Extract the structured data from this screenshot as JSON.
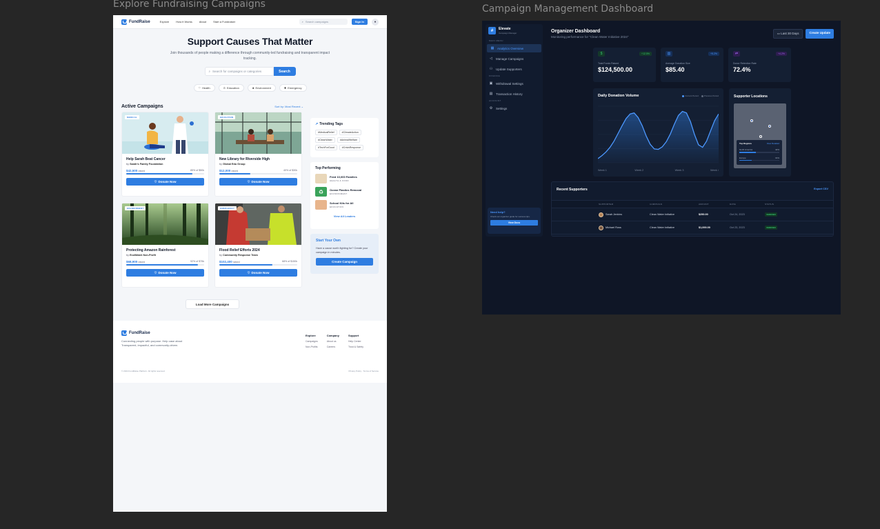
{
  "canvas": {
    "left_title": "Explore Fundraising Campaigns",
    "right_title": "Campaign Management Dashboard"
  },
  "fundraise": {
    "brand": "FundRaise",
    "nav": [
      "Explore",
      "How it Works",
      "About",
      "Start a Fundraiser"
    ],
    "search_placeholder": "Search campaigns",
    "signin_label": "Sign In",
    "hero": {
      "title": "Support Causes That Matter",
      "subtitle": "Join thousands of people making a difference through community-led fundraising and transparent impact tracking.",
      "search_placeholder": "Search for campaigns or categories",
      "search_button": "Search"
    },
    "categories": [
      "Health",
      "Education",
      "Environment",
      "Emergency"
    ],
    "active": {
      "title": "Active Campaigns",
      "sort_label": "Sort by: Most Recent ⌄"
    },
    "campaigns": [
      {
        "tag": "MEDICAL",
        "title": "Help Sarah Beat Cancer",
        "by": "by",
        "org": "Sarah's Family Foundation",
        "raised": "$42,500",
        "raised_word": "raised",
        "goal": "85% of $50k",
        "progress": 0.85,
        "donate": "Donate Now"
      },
      {
        "tag": "EDUCATION",
        "title": "New Library for Riverside High",
        "by": "by",
        "org": "Global Edu Group",
        "raised": "$12,000",
        "raised_word": "raised",
        "goal": "40% of $30k",
        "progress": 0.4,
        "donate": "Donate Now"
      },
      {
        "tag": "ENVIRONMENT",
        "title": "Protecting Amazon Rainforest",
        "by": "by",
        "org": "EcoWatch Non-Profit",
        "raised": "$68,900",
        "raised_word": "raised",
        "goal": "92% of $75k",
        "progress": 0.92,
        "donate": "Donate Now"
      },
      {
        "tag": "EMERGENCY",
        "title": "Flood Relief Efforts 2024",
        "by": "by",
        "org": "Community Response Team",
        "raised": "$102,400",
        "raised_word": "raised",
        "goal": "68% of $150k",
        "progress": 0.68,
        "donate": "Donate Now"
      }
    ],
    "load_more": "Load More Campaigns",
    "trending": {
      "title": "Trending Tags",
      "tags": [
        "#MedicalRelief",
        "#ClimateAction",
        "#CleanWater",
        "#AnimalWelfare",
        "#TechForGood",
        "#CrisisResponse"
      ]
    },
    "top_performing": {
      "title": "Top Performing",
      "items": [
        {
          "name": "Feed 10,000 Families",
          "cat": "HEALTH & FOOD"
        },
        {
          "name": "Ocean Plastics Removal",
          "cat": "ENVIRONMENT"
        },
        {
          "name": "School Kits for All",
          "cat": "EDUCATION"
        }
      ],
      "view_all": "View All Leaders"
    },
    "start": {
      "title": "Start Your Own",
      "text": "Have a cause worth fighting for? Create your campaign in minutes.",
      "button": "Create Campaign"
    },
    "footer": {
      "brand": "FundRaise",
      "desc": "Connecting people with purpose. Help case about Transparent, impactful, and community-driven.",
      "cols": [
        {
          "title": "Explore",
          "links": [
            "Campaigns",
            "Non-Profits"
          ]
        },
        {
          "title": "Company",
          "links": [
            "About us",
            "Careers"
          ]
        },
        {
          "title": "Support",
          "links": [
            "Help Center",
            "Trust & Safety"
          ]
        }
      ],
      "copyright": "© 2024 FundRaise Platform. All rights reserved.",
      "privacy": "Privacy Policy",
      "terms": "Terms of Service"
    }
  },
  "dashboard": {
    "brand": "Elevate",
    "brand_sub": "Campaign Manager",
    "menu_main": "MAIN MENU",
    "menu_finance": "FINANCE",
    "menu_account": "ACCOUNT",
    "menu": {
      "analytics": "Analytics Overview",
      "manage": "Manage Campaigns",
      "update": "Update Supporters",
      "withdrawal": "Withdrawal Settings",
      "history": "Transaction History",
      "settings": "Settings"
    },
    "help": {
      "title": "Need help?",
      "text": "Check our organizer guide for success tips.",
      "button": "View Docs"
    },
    "title": "Organizer Dashboard",
    "subtitle": "Monitoring performance for \"Clean Water Initiative 2024\"",
    "range_label": "Last 30 Days",
    "create_label": "Create Update",
    "kpis": [
      {
        "label": "Total Funds Raised",
        "value": "$124,500.00",
        "delta": "+12.5%",
        "color": "#35c46b",
        "icon": "dollar-icon"
      },
      {
        "label": "Average Donation Size",
        "value": "$85.40",
        "delta": "+5.2%",
        "color": "#4c98ff",
        "icon": "bar-chart-icon"
      },
      {
        "label": "Donor Retention Rate",
        "value": "72.4%",
        "delta": "+4.2%",
        "color": "#a060f0",
        "icon": "repeat-icon"
      }
    ],
    "chart": {
      "title": "Daily Donation Volume",
      "legend_current": "Current Period",
      "legend_previous": "Previous Period"
    },
    "locations": {
      "title": "Supporter Locations",
      "regions_title": "Top Regions",
      "regions_link": "View Detailed",
      "regions": [
        {
          "name": "North America",
          "pct": "42%",
          "value": 0.42
        },
        {
          "name": "Europe",
          "pct": "31%",
          "value": 0.31
        }
      ]
    },
    "supporters": {
      "title": "Recent Supporters",
      "export": "Export CSV",
      "columns": [
        "SUPPORTER",
        "CAMPAIGN",
        "AMOUNT",
        "DATE",
        "STATUS"
      ],
      "rows": [
        {
          "name": "Sarah Jenkins",
          "campaign": "Clean Water Initiative",
          "amount": "$250.00",
          "date": "Oct 24, 2023",
          "status": "VERIFIED"
        },
        {
          "name": "Michael Ross",
          "campaign": "Clean Water Initiative",
          "amount": "$1,000.00",
          "date": "Oct 23, 2023",
          "status": "VERIFIED"
        }
      ]
    },
    "chart_data": {
      "type": "area",
      "title": "Daily Donation Volume",
      "categories": [
        "Week 1",
        "Week 2",
        "Week 3",
        "Week 4"
      ],
      "x": [
        0,
        0.1,
        0.2,
        0.3,
        0.4,
        0.5,
        0.6,
        0.7,
        0.8,
        0.9,
        1.0,
        1.1,
        1.2,
        1.3,
        1.4,
        1.5,
        1.6,
        1.7,
        1.8,
        1.9,
        2.0,
        2.1,
        2.2,
        2.3,
        2.4,
        2.5,
        2.6,
        2.7,
        2.8,
        2.9,
        3.0
      ],
      "series": [
        {
          "name": "Current Period",
          "values": [
            0.08,
            0.14,
            0.21,
            0.3,
            0.42,
            0.57,
            0.72,
            0.86,
            0.95,
            0.97,
            0.88,
            0.72,
            0.52,
            0.36,
            0.27,
            0.26,
            0.31,
            0.41,
            0.56,
            0.75,
            0.92,
            1.0,
            0.97,
            0.8,
            0.55,
            0.35,
            0.3,
            0.42,
            0.62,
            0.82,
            0.95
          ]
        },
        {
          "name": "Previous Period",
          "values": []
        }
      ],
      "ylim": [
        0,
        1.1
      ]
    }
  }
}
